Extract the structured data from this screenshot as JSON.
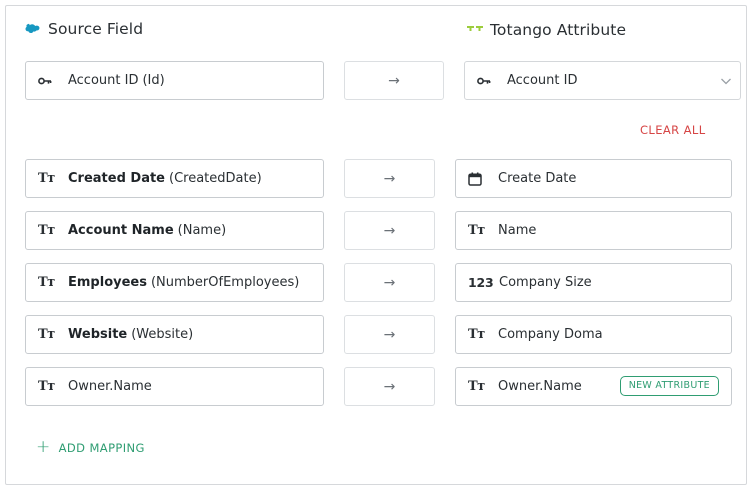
{
  "headers": {
    "source": "Source Field",
    "target": "Totango Attribute"
  },
  "key_mapping": {
    "source_name": "Account ID",
    "source_api": "(Id)",
    "target_value": "Account ID",
    "arrow": "→"
  },
  "actions": {
    "clear_all": "CLEAR ALL",
    "add_mapping": "ADD MAPPING",
    "add_icon": "+"
  },
  "mappings": [
    {
      "source_name": "Created Date",
      "source_api": "(CreatedDate)",
      "source_icon": "text-type-icon",
      "arrow": "→",
      "target_value": "Create Date",
      "target_icon": "calendar-icon",
      "target_icon_text": ""
    },
    {
      "source_name": "Account Name",
      "source_api": "(Name)",
      "source_icon": "text-type-icon",
      "arrow": "→",
      "target_value": "Name",
      "target_icon": "text-type-icon",
      "target_icon_text": ""
    },
    {
      "source_name": "Employees",
      "source_api": "(NumberOfEmployees)",
      "source_icon": "text-type-icon",
      "arrow": "→",
      "target_value": "Company Size",
      "target_icon": "number-type-icon",
      "target_icon_text": "123"
    },
    {
      "source_name": "Website",
      "source_api": "(Website)",
      "source_icon": "text-type-icon",
      "arrow": "→",
      "target_value": "Company Doma",
      "target_icon": "text-type-icon",
      "target_icon_text": ""
    },
    {
      "source_name": "",
      "source_api": "Owner.Name",
      "source_icon": "text-type-icon",
      "arrow": "→",
      "target_value": "Owner.Name",
      "target_icon": "text-type-icon",
      "target_icon_text": "",
      "badge": "NEW ATTRIBUTE"
    }
  ],
  "text_type_glyph": "Tт",
  "colors": {
    "accent_green": "#2f9d72",
    "danger_red": "#d64545",
    "salesforce_blue": "#1798c1",
    "totango_green": "#9ccc3c"
  }
}
